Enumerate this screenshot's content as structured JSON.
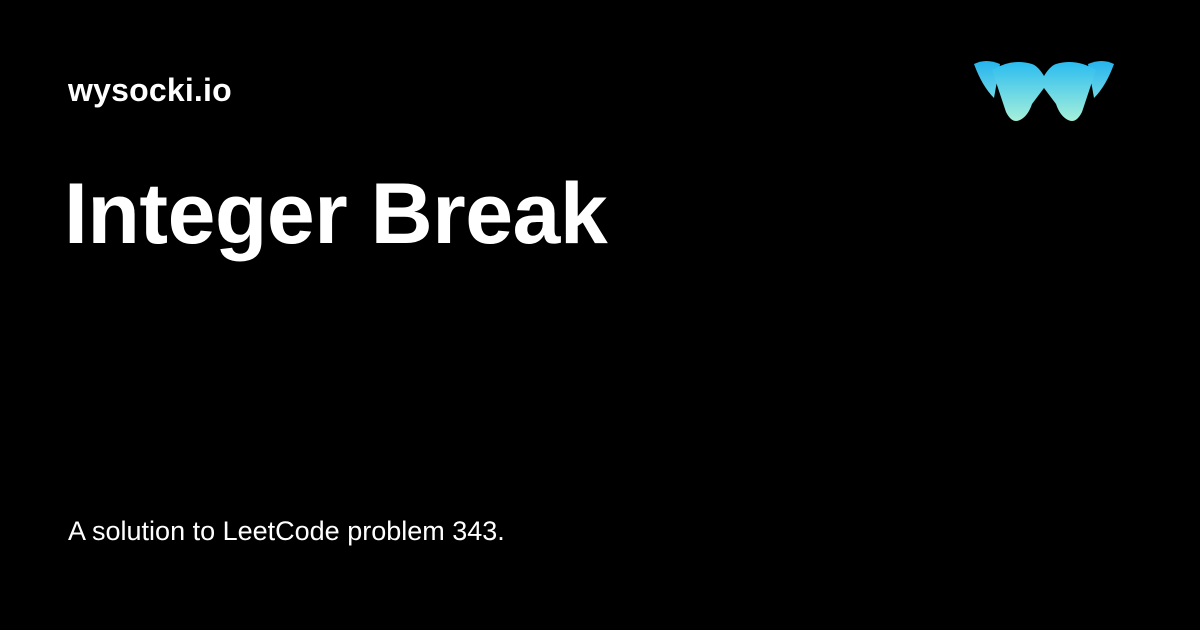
{
  "header": {
    "site_name": "wysocki.io",
    "logo_icon": "wysocki-w-logo-icon"
  },
  "main": {
    "title": "Integer Break",
    "description": "A solution to LeetCode problem 343."
  },
  "colors": {
    "background": "#000000",
    "text": "#ffffff",
    "logo_gradient_top": "#2bbcf0",
    "logo_gradient_bottom": "#a6f0da"
  }
}
